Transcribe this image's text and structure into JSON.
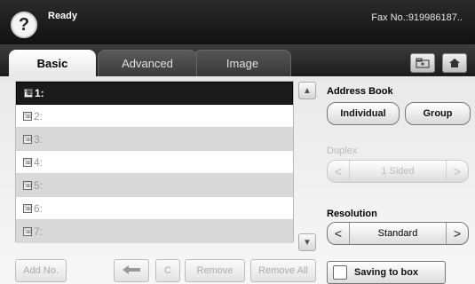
{
  "status_bar": {
    "help_icon": "question-mark",
    "status": "Ready",
    "fax_no": "Fax No.:919986187.."
  },
  "tabs": [
    {
      "label": "Basic",
      "active": true
    },
    {
      "label": "Advanced",
      "active": false
    },
    {
      "label": "Image",
      "active": false
    }
  ],
  "toolbar_icons": [
    "folder-icon",
    "home-icon"
  ],
  "destinations": [
    {
      "label": "1:",
      "selected": true
    },
    {
      "label": "2:",
      "selected": false
    },
    {
      "label": "3:",
      "selected": false
    },
    {
      "label": "4:",
      "selected": false
    },
    {
      "label": "5:",
      "selected": false
    },
    {
      "label": "6:",
      "selected": false
    },
    {
      "label": "7:",
      "selected": false
    }
  ],
  "list_buttons": {
    "add": "Add No.",
    "back_icon": "left-arrow",
    "clear": "C",
    "remove": "Remove",
    "remove_all": "Remove All"
  },
  "address_book": {
    "label": "Address Book",
    "individual": "Individual",
    "group": "Group"
  },
  "duplex": {
    "label": "Duplex",
    "value": "1 Sided"
  },
  "resolution": {
    "label": "Resolution",
    "value": "Standard"
  },
  "saving": {
    "label": "Saving to box",
    "checked": false
  }
}
